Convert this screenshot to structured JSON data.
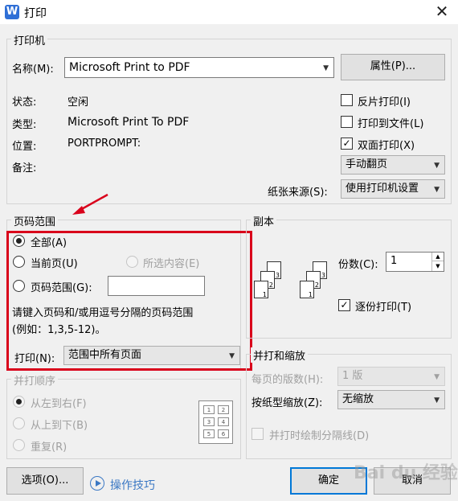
{
  "window": {
    "title": "打印",
    "app_icon": "W",
    "close": "✕"
  },
  "printer": {
    "group_label": "打印机",
    "name_label": "名称(M):",
    "name_value": "Microsoft Print to PDF",
    "properties_button": "属性(P)...",
    "status_label": "状态:",
    "status_value": "空闲",
    "type_label": "类型:",
    "type_value": "Microsoft Print To PDF",
    "location_label": "位置:",
    "location_value": "PORTPROMPT:",
    "comment_label": "备注:",
    "reverse_print": {
      "label": "反片打印(I)",
      "checked": false
    },
    "print_to_file": {
      "label": "打印到文件(L)",
      "checked": false
    },
    "duplex": {
      "label": "双面打印(X)",
      "checked": true
    },
    "duplex_mode": "手动翻页",
    "paper_source_label": "纸张来源(S):",
    "paper_source_value": "使用打印机设置"
  },
  "page_range": {
    "group_label": "页码范围",
    "all": "全部(A)",
    "current": "当前页(U)",
    "selection": "所选内容(E)",
    "range": "页码范围(G):",
    "range_value": "",
    "hint_line1": "请键入页码和/或用逗号分隔的页码范围",
    "hint_line2": "(例如：1,3,5-12)。",
    "print_label": "打印(N):",
    "print_value": "范围中所有页面"
  },
  "copies": {
    "group_label": "副本",
    "count_label": "份数(C):",
    "count_value": "1",
    "collate": {
      "label": "逐份打印(T)",
      "checked": true
    },
    "stack1": [
      "3",
      "2",
      "1"
    ],
    "stack2": [
      "3",
      "2",
      "1"
    ]
  },
  "order": {
    "group_label": "并打顺序",
    "left_right": "从左到右(F)",
    "top_bottom": "从上到下(B)",
    "repeat": "重复(R)",
    "grid": [
      "1",
      "2",
      "3",
      "4",
      "5",
      "6"
    ]
  },
  "zoom": {
    "group_label": "并打和缩放",
    "pages_per_sheet_label": "每页的版数(H):",
    "pages_per_sheet_value": "1 版",
    "scale_label": "按纸型缩放(Z):",
    "scale_value": "无缩放",
    "draw_divider": {
      "label": "并打时绘制分隔线(D)",
      "checked": false
    }
  },
  "footer": {
    "options_button": "选项(O)...",
    "tips_link": "操作技巧",
    "ok_button": "确定",
    "cancel_button": "取消"
  },
  "watermark": "Bai du 经验",
  "colors": {
    "accent": "#0078d7",
    "highlight": "#d9001b",
    "link": "#3b78c4"
  }
}
